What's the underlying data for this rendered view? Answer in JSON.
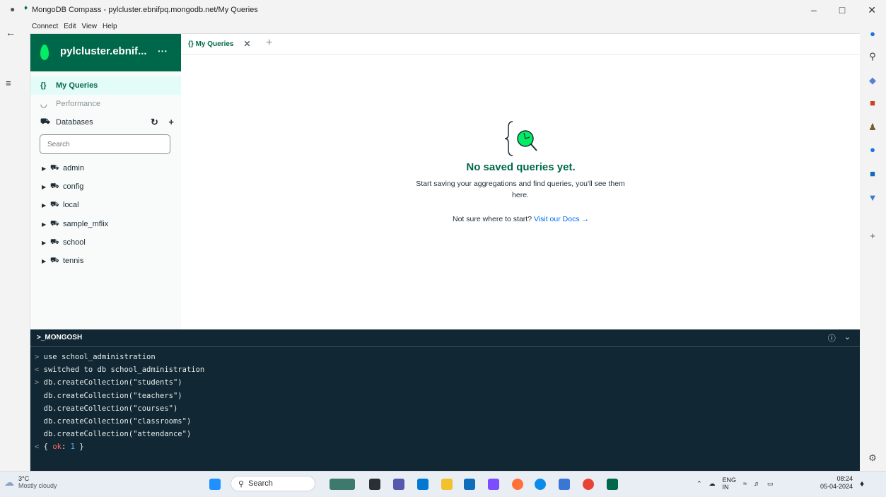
{
  "window": {
    "title": "MongoDB Compass - pylcluster.ebnifpq.mongodb.net/My Queries",
    "menu": [
      "Connect",
      "Edit",
      "View",
      "Help"
    ],
    "controls": [
      "–",
      "□",
      "✕"
    ]
  },
  "connection": {
    "name": "pylcluster.ebnif...",
    "more": "···"
  },
  "sidebar": {
    "my_queries": "My Queries",
    "performance": "Performance",
    "databases": "Databases",
    "refresh": "↻",
    "add": "+",
    "search_placeholder": "Search",
    "dbs": [
      "admin",
      "config",
      "local",
      "sample_mflix",
      "school",
      "tennis"
    ]
  },
  "tab": {
    "icon": "{}",
    "label": "My Queries",
    "close": "✕",
    "new": "+"
  },
  "empty_state": {
    "title": "No saved queries yet.",
    "body": "Start saving your aggregations and find queries, you'll see them here.",
    "help": "Not sure where to start?",
    "link": "Visit our Docs →"
  },
  "shell": {
    "title": ">_MONGOSH",
    "info": "ⓘ",
    "collapse": "⌄",
    "lines": [
      "use school_administration",
      "switched to db school_administration",
      "db.createCollection(\"students\")",
      "db.createCollection(\"teachers\")",
      "db.createCollection(\"courses\")",
      "db.createCollection(\"classrooms\")",
      "db.createCollection(\"attendance\")"
    ],
    "result_open": "{ ",
    "result_key": "ok",
    "result_sep": ": ",
    "result_val": "1",
    "result_close": " }"
  },
  "taskbar": {
    "temp": "3°C",
    "weather": "Mostly cloudy",
    "search": "Search",
    "lang": "ENG",
    "region": "IN",
    "time": "08:24",
    "date": "05-04-2024"
  },
  "colors": {
    "brand_green": "#00684a",
    "leaf_green": "#00ed64",
    "shell_bg": "#112733",
    "link_blue": "#016bf8"
  }
}
